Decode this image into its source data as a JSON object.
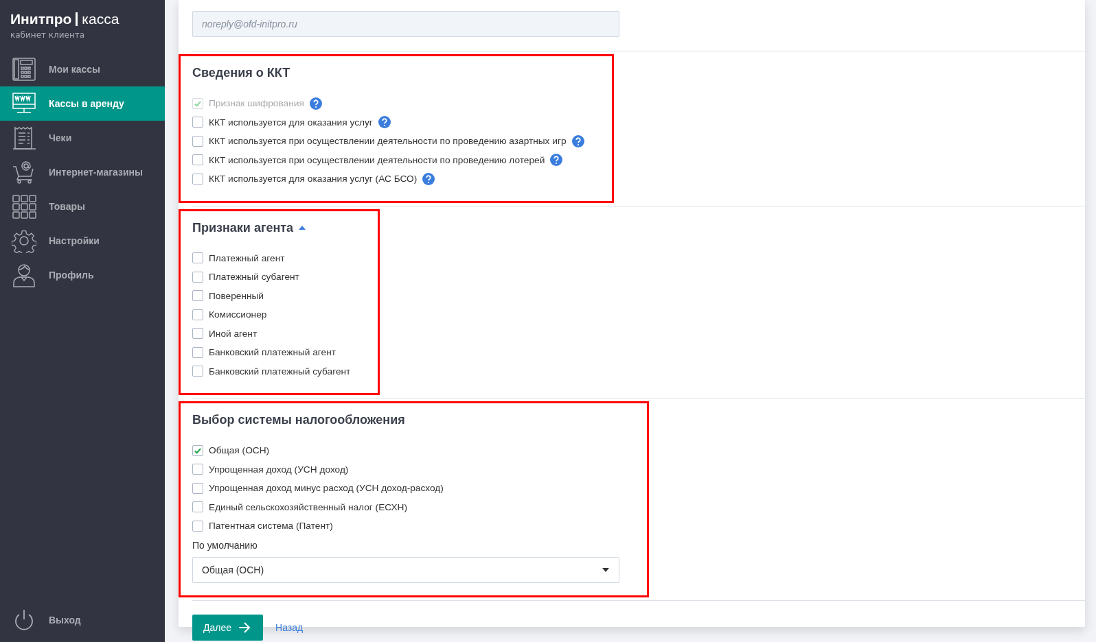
{
  "sidebar": {
    "brand": "Инитпро",
    "product": "касса",
    "subtitle": "кабинет клиента",
    "items": [
      {
        "label": "Мои кассы",
        "selected": false
      },
      {
        "label": "Кассы в аренду",
        "selected": true
      },
      {
        "label": "Чеки",
        "selected": false
      },
      {
        "label": "Интернет-магазины",
        "selected": false
      },
      {
        "label": "Товары",
        "selected": false
      },
      {
        "label": "Настройки",
        "selected": false
      },
      {
        "label": "Профиль",
        "selected": false
      }
    ],
    "logout": "Выход"
  },
  "email_field": {
    "placeholder": "noreply@ofd-initpro.ru"
  },
  "sections": [
    {
      "title": "Сведения о ККТ",
      "highlighted": true,
      "options": [
        {
          "label": "Признак шифрования",
          "checked": true,
          "disabled": true,
          "help": true
        },
        {
          "label": "ККТ используется для оказания услуг",
          "checked": false,
          "disabled": false,
          "help": true
        },
        {
          "label": "ККТ используется при осуществлении деятельности по проведению азартных игр",
          "checked": false,
          "disabled": false,
          "help": true
        },
        {
          "label": "ККТ используется при осуществлении деятельности по проведению лотерей",
          "checked": false,
          "disabled": false,
          "help": true
        },
        {
          "label": "ККТ используется для оказания услуг (АС БСО)",
          "checked": false,
          "disabled": false,
          "help": true
        }
      ]
    },
    {
      "title": "Признаки агента",
      "highlighted": true,
      "expanded": true,
      "options": [
        {
          "label": "Платежный агент",
          "checked": false,
          "disabled": false,
          "help": false
        },
        {
          "label": "Платежный субагент",
          "checked": false,
          "disabled": false,
          "help": false
        },
        {
          "label": "Поверенный",
          "checked": false,
          "disabled": false,
          "help": false
        },
        {
          "label": "Комиссионер",
          "checked": false,
          "disabled": false,
          "help": false
        },
        {
          "label": "Иной агент",
          "checked": false,
          "disabled": false,
          "help": false
        },
        {
          "label": "Банковский платежный агент",
          "checked": false,
          "disabled": false,
          "help": false
        },
        {
          "label": "Банковский платежный субагент",
          "checked": false,
          "disabled": false,
          "help": false
        }
      ]
    },
    {
      "title": "Выбор системы налогообложения",
      "highlighted": true,
      "options": [
        {
          "label": "Общая (ОСН)",
          "checked": true,
          "disabled": false,
          "help": false
        },
        {
          "label": "Упрощенная доход (УСН доход)",
          "checked": false,
          "disabled": false,
          "help": false
        },
        {
          "label": "Упрощенная доход минус расход (УСН доход-расход)",
          "checked": false,
          "disabled": false,
          "help": false
        },
        {
          "label": "Единый сельскохозяйственный налог (ЕСХН)",
          "checked": false,
          "disabled": false,
          "help": false
        },
        {
          "label": "Патентная система (Патент)",
          "checked": false,
          "disabled": false,
          "help": false
        }
      ],
      "default": {
        "label": "По умолчанию",
        "value": "Общая (ОСН)"
      }
    }
  ],
  "actions": {
    "next": "Далее",
    "back": "Назад"
  }
}
